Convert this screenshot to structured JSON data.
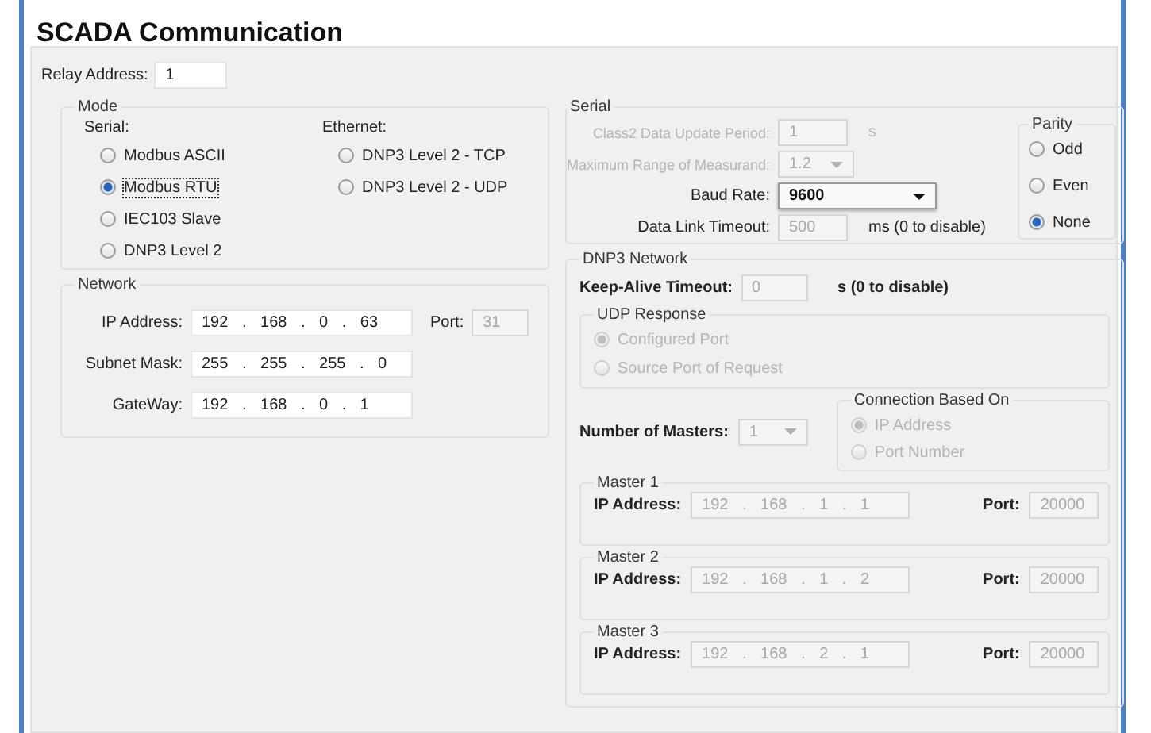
{
  "title": "SCADA Communication",
  "relay_address": {
    "label": "Relay Address:",
    "value": "1"
  },
  "mode": {
    "title": "Mode",
    "columns": [
      {
        "heading": "Serial:",
        "options": [
          {
            "label": "Modbus ASCII",
            "selected": false,
            "focused": false
          },
          {
            "label": "Modbus RTU",
            "selected": true,
            "focused": true
          },
          {
            "label": "IEC103 Slave",
            "selected": false,
            "focused": false
          },
          {
            "label": "DNP3 Level 2",
            "selected": false,
            "focused": false
          }
        ]
      },
      {
        "heading": "Ethernet:",
        "options": [
          {
            "label": "DNP3 Level 2 - TCP",
            "selected": false,
            "focused": false
          },
          {
            "label": "DNP3 Level 2 - UDP",
            "selected": false,
            "focused": false
          }
        ]
      }
    ]
  },
  "network": {
    "title": "Network",
    "rows": [
      {
        "label": "IP Address:",
        "value": "192 . 168 . 0 . 63",
        "port_label": "Port:",
        "port": "31"
      },
      {
        "label": "Subnet Mask:",
        "value": "255 . 255 . 255 . 0"
      },
      {
        "label": "GateWay:",
        "value": "192 . 168 . 0 . 1"
      }
    ]
  },
  "serial": {
    "title": "Serial",
    "rows": [
      {
        "kind": "text",
        "label": "Class2 Data Update Period:",
        "value": "1",
        "unit": "s",
        "label_disabled": true,
        "disabled": true
      },
      {
        "kind": "select",
        "label": "Maximum Range of Measurand:",
        "value": "1.2",
        "label_disabled": true,
        "disabled": true
      },
      {
        "kind": "select",
        "label": "Baud Rate:",
        "value": "9600",
        "label_disabled": false,
        "disabled": false
      },
      {
        "kind": "text",
        "label": "Data Link Timeout:",
        "value": "500",
        "unit": "ms (0 to disable)",
        "label_disabled": false,
        "disabled": true
      }
    ],
    "parity": {
      "title": "Parity",
      "options": [
        {
          "label": "Odd",
          "selected": false
        },
        {
          "label": "Even",
          "selected": false
        },
        {
          "label": "None",
          "selected": true
        }
      ]
    }
  },
  "dnp3": {
    "title": "DNP3 Network",
    "keep_alive": {
      "label": "Keep-Alive Timeout:",
      "value": "0",
      "unit": "s (0 to disable)",
      "disabled": true
    },
    "udp_response": {
      "title": "UDP Response",
      "options": [
        {
          "label": "Configured Port",
          "selected": true,
          "disabled": true
        },
        {
          "label": "Source Port of Request",
          "selected": false,
          "disabled": true
        }
      ]
    },
    "number_of_masters": {
      "label": "Number of Masters:",
      "value": "1",
      "disabled": true
    },
    "connection_based_on": {
      "title": "Connection Based On",
      "options": [
        {
          "label": "IP Address",
          "selected": true,
          "disabled": true
        },
        {
          "label": "Port Number",
          "selected": false,
          "disabled": true
        }
      ]
    },
    "masters": [
      {
        "title": "Master 1",
        "ip_label": "IP Address:",
        "ip": "192 . 168 . 1 . 1",
        "port_label": "Port:",
        "port": "20000",
        "disabled": true
      },
      {
        "title": "Master 2",
        "ip_label": "IP Address:",
        "ip": "192 . 168 . 1 . 2",
        "port_label": "Port:",
        "port": "20000",
        "disabled": true
      },
      {
        "title": "Master 3",
        "ip_label": "IP Address:",
        "ip": "192 . 168 . 2 . 1",
        "port_label": "Port:",
        "port": "20000",
        "disabled": true
      }
    ]
  }
}
